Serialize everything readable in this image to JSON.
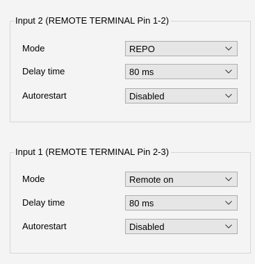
{
  "groups": [
    {
      "title": "Input 2 (REMOTE TERMINAL Pin 1-2)",
      "rows": [
        {
          "label": "Mode",
          "value": "REPO"
        },
        {
          "label": "Delay time",
          "value": "80 ms"
        },
        {
          "label": "Autorestart",
          "value": "Disabled"
        }
      ]
    },
    {
      "title": "Input 1 (REMOTE TERMINAL Pin 2-3)",
      "rows": [
        {
          "label": "Mode",
          "value": "Remote on"
        },
        {
          "label": "Delay time",
          "value": "80 ms"
        },
        {
          "label": "Autorestart",
          "value": "Disabled"
        }
      ]
    }
  ],
  "icons": {
    "dropdown": "chevron-down-icon"
  },
  "colors": {
    "background": "#f4f4f4",
    "groupBorder": "#d6d6d6",
    "selectBackground": "#e6e6e6",
    "selectBorder": "#adadad"
  }
}
